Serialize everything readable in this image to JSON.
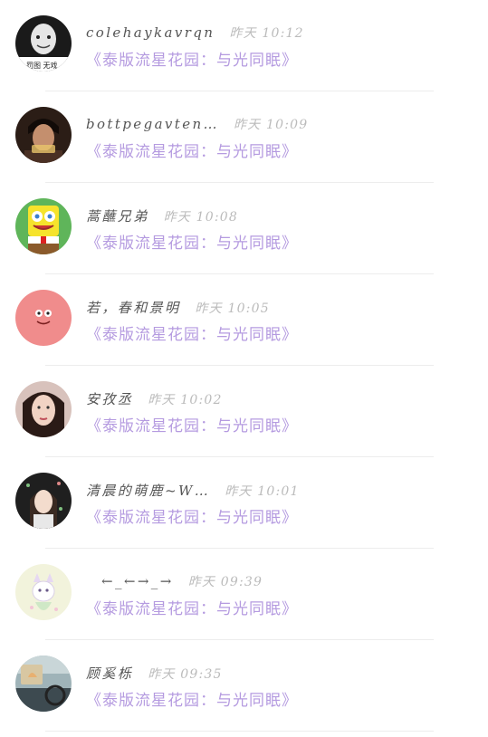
{
  "items": [
    {
      "name": "colehaykavrqn",
      "time": "昨天 10:12",
      "topic": "《泰版流星花园：与光同眠》",
      "avatar_icon": "bw-portrait-avatar",
      "avatar_color": "#d8d8d8"
    },
    {
      "name": "bottpegavten…",
      "time": "昨天 10:09",
      "topic": "《泰版流星花园：与光同眠》",
      "avatar_icon": "dark-portrait-avatar",
      "avatar_color": "#6b4a3a"
    },
    {
      "name": "蒿蘸兄弟",
      "time": "昨天 10:08",
      "topic": "《泰版流星花园：与光同眠》",
      "avatar_icon": "spongebob-avatar",
      "avatar_color": "#f2e32a"
    },
    {
      "name": "若，春和景明",
      "time": "昨天 10:05",
      "topic": "《泰版流星花园：与光同眠》",
      "avatar_icon": "patrick-avatar",
      "avatar_color": "#f08a8a"
    },
    {
      "name": "安孜丞",
      "time": "昨天 10:02",
      "topic": "《泰版流星花园：与光同眠》",
      "avatar_icon": "girl-portrait-avatar",
      "avatar_color": "#c7a59c"
    },
    {
      "name": "清晨的萌鹿~W…",
      "time": "昨天 10:01",
      "topic": "《泰版流星花园：与光同眠》",
      "avatar_icon": "illustrated-girl-avatar",
      "avatar_color": "#2a2a2a"
    },
    {
      "name": "←_←→_→",
      "time": "昨天 09:39",
      "topic": "《泰版流星花园：与光同眠》",
      "avatar_icon": "anime-cat-avatar",
      "avatar_color": "#eef0cf"
    },
    {
      "name": "顾奚栎",
      "time": "昨天 09:35",
      "topic": "《泰版流星花园：与光同眠》",
      "avatar_icon": "car-photo-avatar",
      "avatar_color": "#8aa0a8"
    }
  ]
}
